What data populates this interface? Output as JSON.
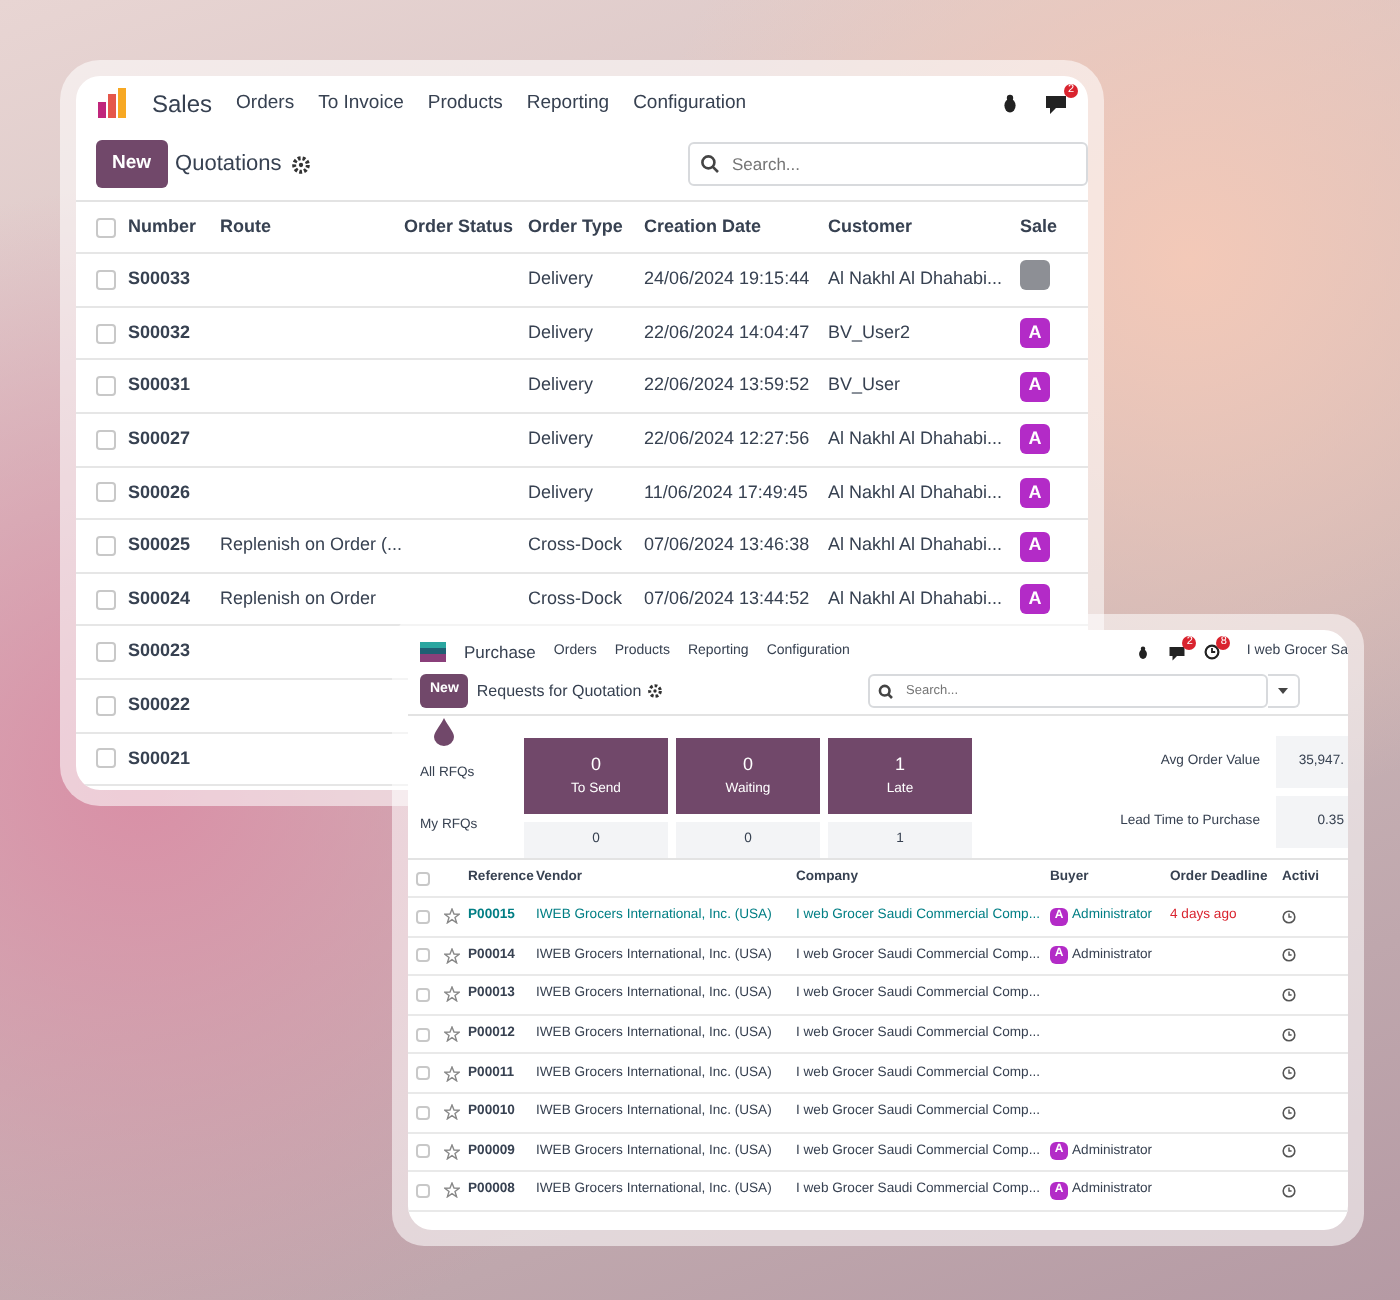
{
  "background": {
    "kind": "photo"
  },
  "sales": {
    "app": "Sales",
    "menu": [
      "Orders",
      "To Invoice",
      "Products",
      "Reporting",
      "Configuration"
    ],
    "chat_badge": "2",
    "new_button": "New",
    "title": "Quotations",
    "search": {
      "placeholder": "Search..."
    },
    "columns": [
      "Number",
      "Route",
      "Order Status",
      "Order Type",
      "Creation Date",
      "Customer",
      "Sale"
    ],
    "select_all_checked": false,
    "rows": [
      {
        "number": "S00033",
        "type": "Delivery",
        "date": "24/06/2024 19:15:44",
        "customer": "Al Nakhl Al Dhahabi...",
        "avatar": {
          "kind": "photo"
        },
        "checked": false
      },
      {
        "number": "S00032",
        "type": "Delivery",
        "date": "22/06/2024 14:04:47",
        "customer": "BV_User2",
        "avatar": {
          "kind": "letter",
          "text": "A"
        },
        "checked": false
      },
      {
        "number": "S00031",
        "type": "Delivery",
        "date": "22/06/2024 13:59:52",
        "customer": "BV_User",
        "avatar": {
          "kind": "letter",
          "text": "A"
        },
        "checked": false
      },
      {
        "number": "S00027",
        "type": "Delivery",
        "date": "22/06/2024 12:27:56",
        "customer": "Al Nakhl Al Dhahabi...",
        "avatar": {
          "kind": "letter",
          "text": "A"
        },
        "checked": false
      },
      {
        "number": "S00026",
        "type": "Delivery",
        "date": "11/06/2024 17:49:45",
        "customer": "Al Nakhl Al Dhahabi...",
        "avatar": {
          "kind": "letter",
          "text": "A"
        },
        "checked": false
      },
      {
        "number": "S00025",
        "route": "Replenish on Order (...",
        "type": "Cross-Dock",
        "date": "07/06/2024 13:46:38",
        "customer": "Al Nakhl Al Dhahabi...",
        "avatar": {
          "kind": "letter",
          "text": "A"
        },
        "checked": false
      },
      {
        "number": "S00024",
        "route": "Replenish on Order",
        "type": "Cross-Dock",
        "date": "07/06/2024 13:44:52",
        "customer": "Al Nakhl Al Dhahabi...",
        "avatar": {
          "kind": "letter",
          "text": "A"
        },
        "checked": false
      },
      {
        "number": "S00023",
        "checked": false
      },
      {
        "number": "S00022",
        "checked": false
      },
      {
        "number": "S00021",
        "checked": false
      }
    ]
  },
  "purchase": {
    "app": "Purchase",
    "menu": [
      "Orders",
      "Products",
      "Reporting",
      "Configuration"
    ],
    "chat_badge": "2",
    "activity_badge": "8",
    "company": "I web Grocer Sa",
    "new_button": "New",
    "title": "Requests for Quotation",
    "search": {
      "placeholder": "Search..."
    },
    "stats": {
      "row_labels": [
        "All RFQs",
        "My RFQs"
      ],
      "tiles": [
        {
          "value": "0",
          "label": "To Send",
          "mine": "0"
        },
        {
          "value": "0",
          "label": "Waiting",
          "mine": "0"
        },
        {
          "value": "1",
          "label": "Late",
          "mine": "1"
        }
      ],
      "kpis": [
        {
          "label": "Avg Order Value",
          "value": "35,947."
        },
        {
          "label": "Lead Time to Purchase",
          "value": "0.35"
        }
      ]
    },
    "columns": [
      "Reference",
      "Vendor",
      "Company",
      "Buyer",
      "Order Deadline",
      "Activi"
    ],
    "select_all_checked": false,
    "rows": [
      {
        "reference": "P00015",
        "vendor": "IWEB Grocers International, Inc. (USA)",
        "company": "I web Grocer Saudi Commercial Comp...",
        "buyer": {
          "initial": "A",
          "name": "Administrator"
        },
        "deadline": "4 days ago",
        "highlighted": true,
        "starred": false,
        "checked": false
      },
      {
        "reference": "P00014",
        "vendor": "IWEB Grocers International, Inc. (USA)",
        "company": "I web Grocer Saudi Commercial Comp...",
        "buyer": {
          "initial": "A",
          "name": "Administrator"
        },
        "highlighted": false,
        "starred": false,
        "checked": false
      },
      {
        "reference": "P00013",
        "vendor": "IWEB Grocers International, Inc. (USA)",
        "company": "I web Grocer Saudi Commercial Comp...",
        "highlighted": false,
        "starred": false,
        "checked": false
      },
      {
        "reference": "P00012",
        "vendor": "IWEB Grocers International, Inc. (USA)",
        "company": "I web Grocer Saudi Commercial Comp...",
        "highlighted": false,
        "starred": false,
        "checked": false
      },
      {
        "reference": "P00011",
        "vendor": "IWEB Grocers International, Inc. (USA)",
        "company": "I web Grocer Saudi Commercial Comp...",
        "highlighted": false,
        "starred": false,
        "checked": false
      },
      {
        "reference": "P00010",
        "vendor": "IWEB Grocers International, Inc. (USA)",
        "company": "I web Grocer Saudi Commercial Comp...",
        "highlighted": false,
        "starred": false,
        "checked": false
      },
      {
        "reference": "P00009",
        "vendor": "IWEB Grocers International, Inc. (USA)",
        "company": "I web Grocer Saudi Commercial Comp...",
        "buyer": {
          "initial": "A",
          "name": "Administrator"
        },
        "highlighted": false,
        "starred": false,
        "checked": false
      },
      {
        "reference": "P00008",
        "vendor": "IWEB Grocers International, Inc. (USA)",
        "company": "I web Grocer Saudi Commercial Comp...",
        "buyer": {
          "initial": "A",
          "name": "Administrator"
        },
        "highlighted": false,
        "starred": false,
        "checked": false
      }
    ]
  }
}
